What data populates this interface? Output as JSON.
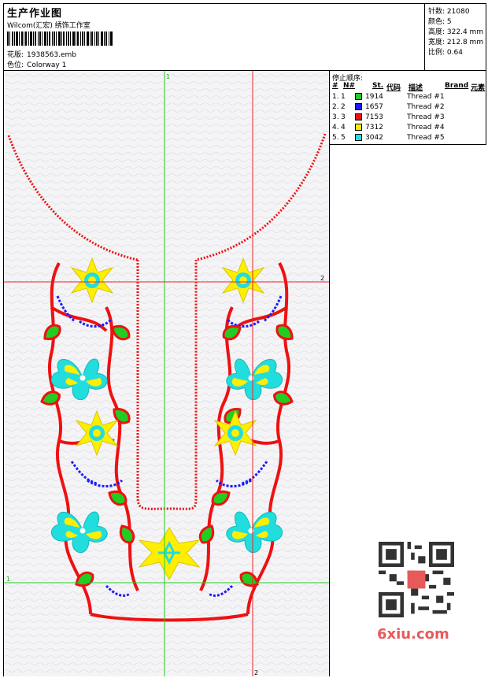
{
  "header": {
    "title": "生产作业图",
    "subtitle": "Wilcom(汇宏) 绣饰工作室",
    "file_label": "花版:",
    "file_value": "1938563.emb",
    "colorway_label": "色位:",
    "colorway_value": "Colorway 1"
  },
  "stats": {
    "stitches_label": "针数:",
    "stitches_value": "21080",
    "colors_label": "颜色:",
    "colors_value": "5",
    "height_label": "高度:",
    "height_value": "322.4 mm",
    "width_label": "宽度:",
    "width_value": "212.8 mm",
    "scale_label": "比例:",
    "scale_value": "0.64"
  },
  "stop_sequence": {
    "title": "停止顺序:",
    "columns": [
      "#",
      "N#",
      "St.",
      "代码",
      "描述",
      "Brand",
      "元素"
    ],
    "rows": [
      {
        "num": "1.",
        "n": "1",
        "color": "#22cc22",
        "code": "1914",
        "desc": "Thread #1"
      },
      {
        "num": "2.",
        "n": "2",
        "color": "#1a1aff",
        "code": "1657",
        "desc": "Thread #2"
      },
      {
        "num": "3.",
        "n": "3",
        "color": "#ee1111",
        "code": "7153",
        "desc": "Thread #3"
      },
      {
        "num": "4.",
        "n": "4",
        "color": "#ffee00",
        "code": "7312",
        "desc": "Thread #4"
      },
      {
        "num": "5.",
        "n": "5",
        "color": "#22dddd",
        "code": "3042",
        "desc": "Thread #5"
      }
    ]
  },
  "guides": {
    "green_vertical_label": "1",
    "green_horizontal_label": "1",
    "red_vertical_label": "2",
    "red_horizontal_label": "2"
  },
  "colors": {
    "guide_green": "#22cc22",
    "guide_red": "#ee2222",
    "canvas_bg": "#f4f4f6"
  },
  "watermark": {
    "text": "6xiu.com",
    "qr_icon": "qr-code-icon"
  }
}
